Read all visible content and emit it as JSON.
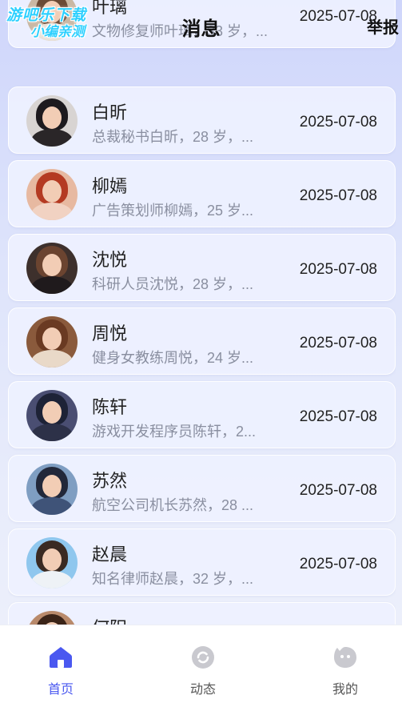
{
  "header": {
    "watermark_line1": "游吧乐下载",
    "watermark_line2": "小编亲测",
    "title": "消息",
    "report_label": "举报"
  },
  "messages": [
    {
      "name": "叶璃",
      "preview": "文物修复师叶璃，33 岁，...",
      "date": "2025-07-08",
      "avatar_colors": {
        "bg": "#c9b7a3",
        "hair": "#6b4a35",
        "body": "#e9e1d8"
      }
    },
    {
      "name": "白昕",
      "preview": "总裁秘书白昕，28 岁，...",
      "date": "2025-07-08",
      "avatar_colors": {
        "bg": "#d8d4d2",
        "hair": "#1d1a1e",
        "body": "#2a2628"
      }
    },
    {
      "name": "柳嫣",
      "preview": "广告策划师柳嫣，25 岁...",
      "date": "2025-07-08",
      "avatar_colors": {
        "bg": "#e7b9a1",
        "hair": "#b43a22",
        "body": "#f1d2c2"
      }
    },
    {
      "name": "沈悦",
      "preview": "科研人员沈悦，28 岁，...",
      "date": "2025-07-08",
      "avatar_colors": {
        "bg": "#3d302c",
        "hair": "#6b4430",
        "body": "#1f1a1c"
      }
    },
    {
      "name": "周悦",
      "preview": "健身女教练周悦，24 岁...",
      "date": "2025-07-08",
      "avatar_colors": {
        "bg": "#8a5a3c",
        "hair": "#6a3a22",
        "body": "#e9d9c8"
      }
    },
    {
      "name": "陈轩",
      "preview": "游戏开发程序员陈轩，2...",
      "date": "2025-07-08",
      "avatar_colors": {
        "bg": "#4a4e72",
        "hair": "#1d2236",
        "body": "#2d3148"
      }
    },
    {
      "name": "苏然",
      "preview": "航空公司机长苏然，28 ...",
      "date": "2025-07-08",
      "avatar_colors": {
        "bg": "#7f9ec2",
        "hair": "#22283a",
        "body": "#3f5378"
      }
    },
    {
      "name": "赵晨",
      "preview": "知名律师赵晨，32 岁，...",
      "date": "2025-07-08",
      "avatar_colors": {
        "bg": "#8fc7ee",
        "hair": "#3a2a22",
        "body": "#eef2f6"
      }
    },
    {
      "name": "何阳",
      "preview": "",
      "date": "",
      "avatar_colors": {
        "bg": "#b98a6b",
        "hair": "#3b2418",
        "body": "#c69a7c"
      }
    }
  ],
  "tabs": [
    {
      "label": "首页",
      "icon": "home-icon",
      "active": true
    },
    {
      "label": "动态",
      "icon": "moments-icon",
      "active": false
    },
    {
      "label": "我的",
      "icon": "profile-icon",
      "active": false
    }
  ],
  "colors": {
    "accent": "#4a58f0",
    "inactive_icon": "#c9c9cf"
  }
}
